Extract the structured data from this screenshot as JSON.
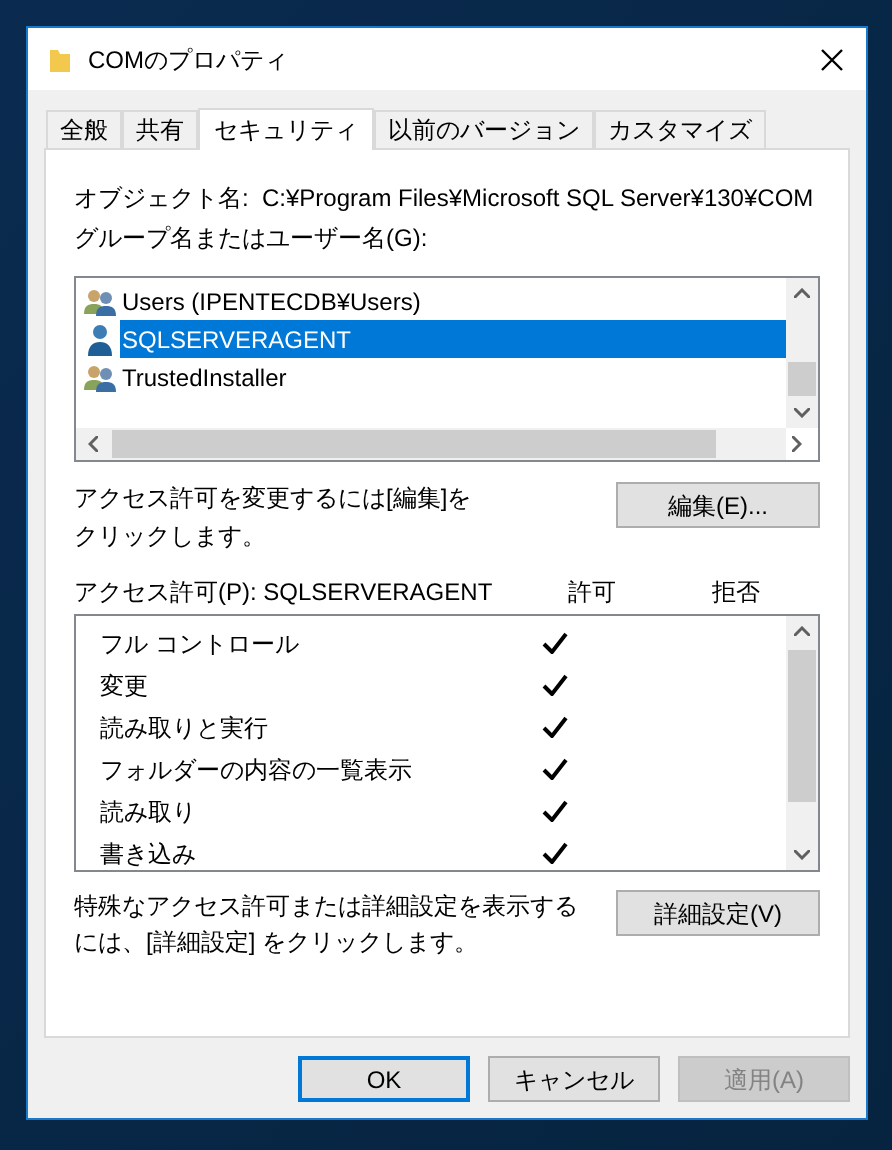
{
  "window": {
    "title": "COMのプロパティ"
  },
  "tabs": [
    {
      "label": "全般",
      "selected": false
    },
    {
      "label": "共有",
      "selected": false
    },
    {
      "label": "セキュリティ",
      "selected": true
    },
    {
      "label": "以前のバージョン",
      "selected": false
    },
    {
      "label": "カスタマイズ",
      "selected": false
    }
  ],
  "object_name": {
    "label": "オブジェクト名:",
    "value": "C:¥Program Files¥Microsoft SQL Server¥130¥COM"
  },
  "principals": {
    "label": "グループ名またはユーザー名(G):",
    "items": [
      {
        "name": "Users (IPENTECDB¥Users)",
        "kind": "group",
        "selected": false
      },
      {
        "name": "SQLSERVERAGENT",
        "kind": "user",
        "selected": true
      },
      {
        "name": "TrustedInstaller",
        "kind": "group",
        "selected": false
      }
    ]
  },
  "edit_hint": "アクセス許可を変更するには[編集]をクリックします。",
  "edit_button": "編集(E)...",
  "permissions": {
    "label": "アクセス許可(P): SQLSERVERAGENT",
    "allow_header": "許可",
    "deny_header": "拒否",
    "rows": [
      {
        "name": "フル コントロール",
        "allow": true,
        "deny": false
      },
      {
        "name": "変更",
        "allow": true,
        "deny": false
      },
      {
        "name": "読み取りと実行",
        "allow": true,
        "deny": false
      },
      {
        "name": "フォルダーの内容の一覧表示",
        "allow": true,
        "deny": false
      },
      {
        "name": "読み取り",
        "allow": true,
        "deny": false
      },
      {
        "name": "書き込み",
        "allow": true,
        "deny": false
      }
    ]
  },
  "advanced_hint": "特殊なアクセス許可または詳細設定を表示するには、[詳細設定] をクリックします。",
  "advanced_button": "詳細設定(V)",
  "buttons": [
    {
      "label": "OK",
      "default": true,
      "disabled": false
    },
    {
      "label": "キャンセル",
      "default": false,
      "disabled": false
    },
    {
      "label": "適用(A)",
      "default": false,
      "disabled": true
    }
  ]
}
